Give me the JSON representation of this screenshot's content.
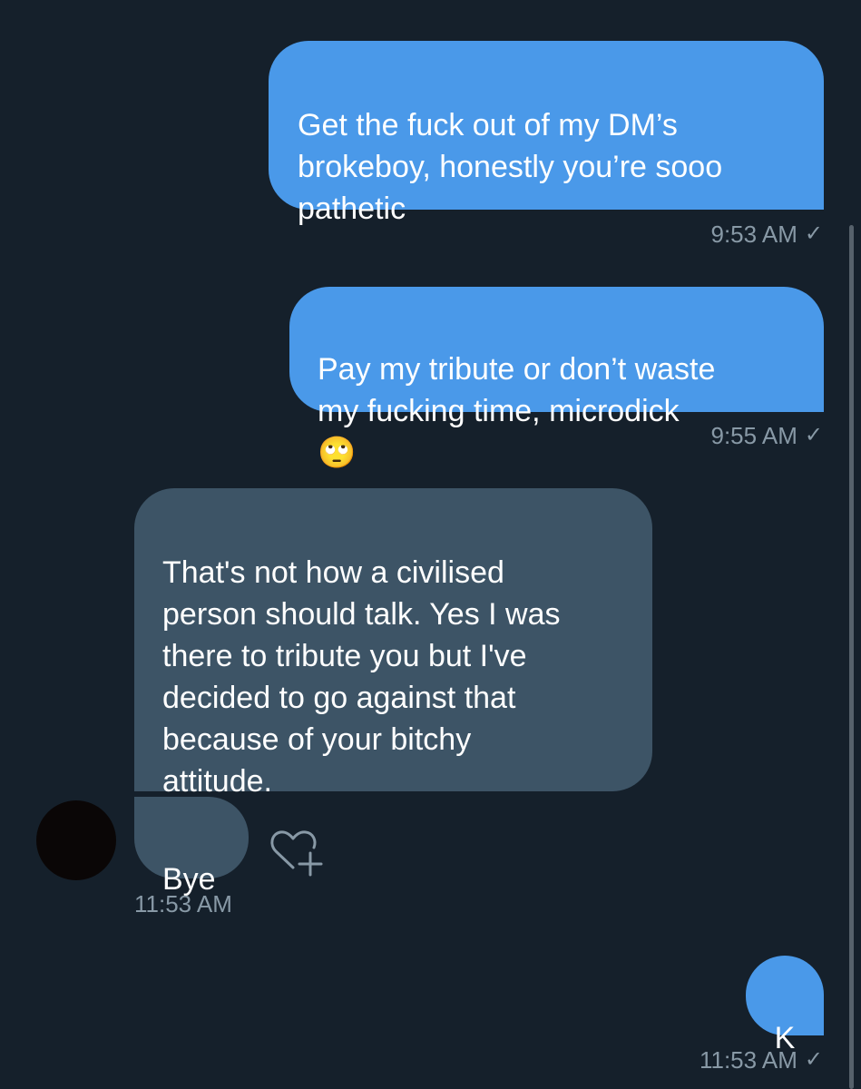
{
  "theme": {
    "background": "#15202b",
    "sent_bubble_color": "#4a99e9",
    "received_bubble_color": "#3d5466",
    "meta_text_color": "#8899a6"
  },
  "messages": [
    {
      "direction": "sent",
      "text": "Get the fuck out of my DM’s\nbrokeboy, honestly you’re sooo\npathetic",
      "time": "9:53 AM",
      "status_icon": "checkmark-icon",
      "status_glyph": "✓"
    },
    {
      "direction": "sent",
      "text": "Pay my tribute or don’t waste\nmy fucking time, microdick",
      "emoji": "🙄",
      "emoji_icon": "face-with-rolling-eyes-icon",
      "time": "9:55 AM",
      "status_icon": "checkmark-icon",
      "status_glyph": "✓"
    },
    {
      "direction": "received",
      "text": "That's not how a civilised\nperson should talk. Yes I was\nthere to tribute you but I've\ndecided to go against that\nbecause of your bitchy\nattitude."
    },
    {
      "direction": "received",
      "text": "Bye",
      "time": "11:53 AM",
      "reaction_icon": "add-reaction-heart-icon"
    },
    {
      "direction": "sent",
      "text": "K",
      "time": "11:53 AM",
      "status_icon": "checkmark-icon",
      "status_glyph": "✓"
    }
  ]
}
